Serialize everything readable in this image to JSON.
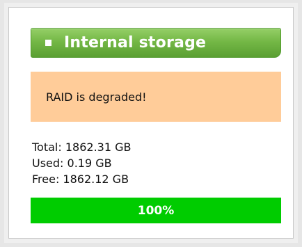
{
  "widget": {
    "title": "Internal storage",
    "bullet_icon": "square-bullet-icon",
    "header_color": "#74b846"
  },
  "alert": {
    "message": "RAID is degraded!",
    "color": "#ffcc99"
  },
  "stats": {
    "total": "Total: 1862.31 GB",
    "used": "Used: 0.19 GB",
    "free": "Free: 1862.12 GB"
  },
  "progress": {
    "label": "100%",
    "fraction": 1.0,
    "color": "#00cc00"
  }
}
